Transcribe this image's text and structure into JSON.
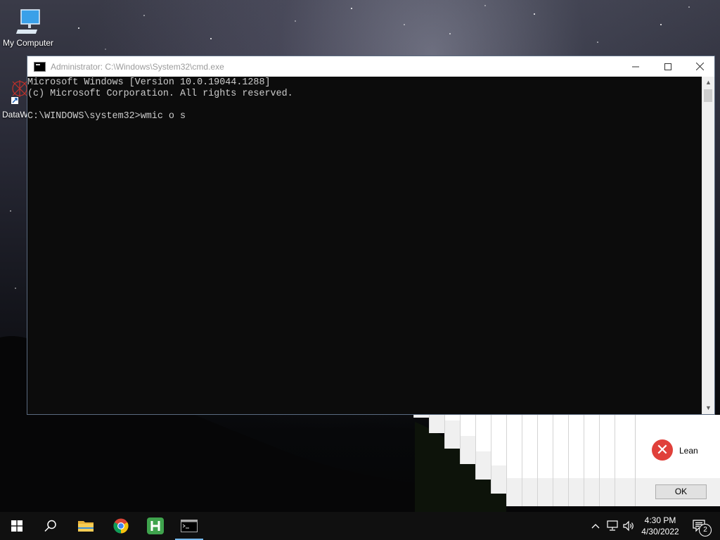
{
  "desktop": {
    "icons": [
      {
        "label": "My Computer",
        "icon": "monitor-icon"
      },
      {
        "label": "DataW",
        "icon": "datawatch-shortcut-icon"
      }
    ]
  },
  "cmd_window": {
    "title": "Administrator: C:\\Windows\\System32\\cmd.exe",
    "controls": {
      "minimize": "minimize-icon",
      "maximize": "maximize-icon",
      "close": "close-icon"
    },
    "console_lines": [
      "Microsoft Windows [Version 10.0.19044.1288]",
      "(c) Microsoft Corporation. All rights reserved.",
      "",
      "C:\\WINDOWS\\system32>wmic o s"
    ],
    "scrollbar": {
      "up": "scroll-up-arrow",
      "down": "scroll-down-arrow"
    }
  },
  "error_dialog": {
    "message": "Lean",
    "button": "OK",
    "icon": "error-x-icon",
    "color": "#e0403a"
  },
  "taskbar": {
    "apps": [
      {
        "name": "start",
        "icon": "windows-logo-icon"
      },
      {
        "name": "search",
        "icon": "search-icon"
      },
      {
        "name": "file-explorer",
        "icon": "folder-icon"
      },
      {
        "name": "chrome",
        "icon": "chrome-icon"
      },
      {
        "name": "h-app",
        "icon": "h-app-icon"
      },
      {
        "name": "cmd",
        "icon": "terminal-icon"
      }
    ],
    "tray": {
      "chevron": "chevron-up-icon",
      "network": "network-icon",
      "volume": "volume-icon"
    },
    "clock": {
      "time": "4:30 PM",
      "date": "4/30/2022"
    },
    "notifications": {
      "count": "2"
    }
  }
}
